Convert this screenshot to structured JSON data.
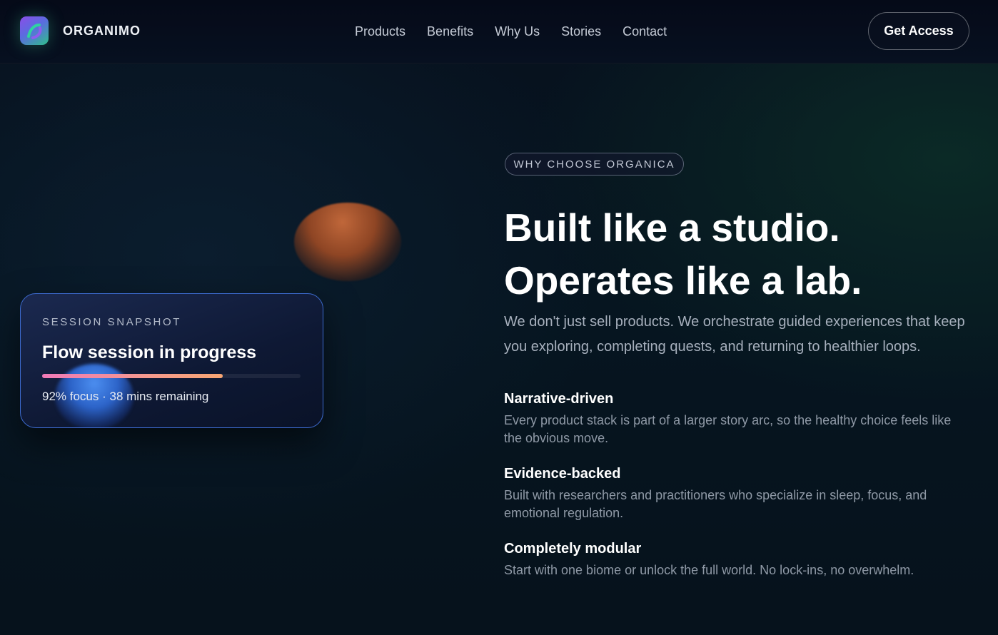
{
  "nav": {
    "brand": "ORGANIMO",
    "links": [
      "Products",
      "Benefits",
      "Why Us",
      "Stories",
      "Contact"
    ],
    "cta": "Get Access"
  },
  "card": {
    "eyebrow": "SESSION SNAPSHOT",
    "title": "Flow session in progress",
    "progress": 0.7,
    "meta": "92% focus · 38 mins remaining"
  },
  "hero": {
    "pill": "WHY CHOOSE ORGANICA",
    "headline_line1": "Built like a studio.",
    "headline_line2": "Operates like a lab.",
    "lede": "We don't just sell products. We orchestrate guided experiences that keep you exploring, completing quests, and returning to healthier loops."
  },
  "features": [
    {
      "title": "Narrative-driven",
      "desc": "Every product stack is part of a larger story arc, so the healthy choice feels like the obvious move."
    },
    {
      "title": "Evidence-backed",
      "desc": "Built with researchers and practitioners who specialize in sleep, focus, and emotional regulation."
    },
    {
      "title": "Completely modular",
      "desc": "Start with one biome or unlock the full world. No lock-ins, no overwhelm."
    }
  ],
  "colors": {
    "accent_border": "#3d6bd0",
    "progress_start": "#f07ab8",
    "progress_end": "#f7a572",
    "background": "#07111e"
  }
}
